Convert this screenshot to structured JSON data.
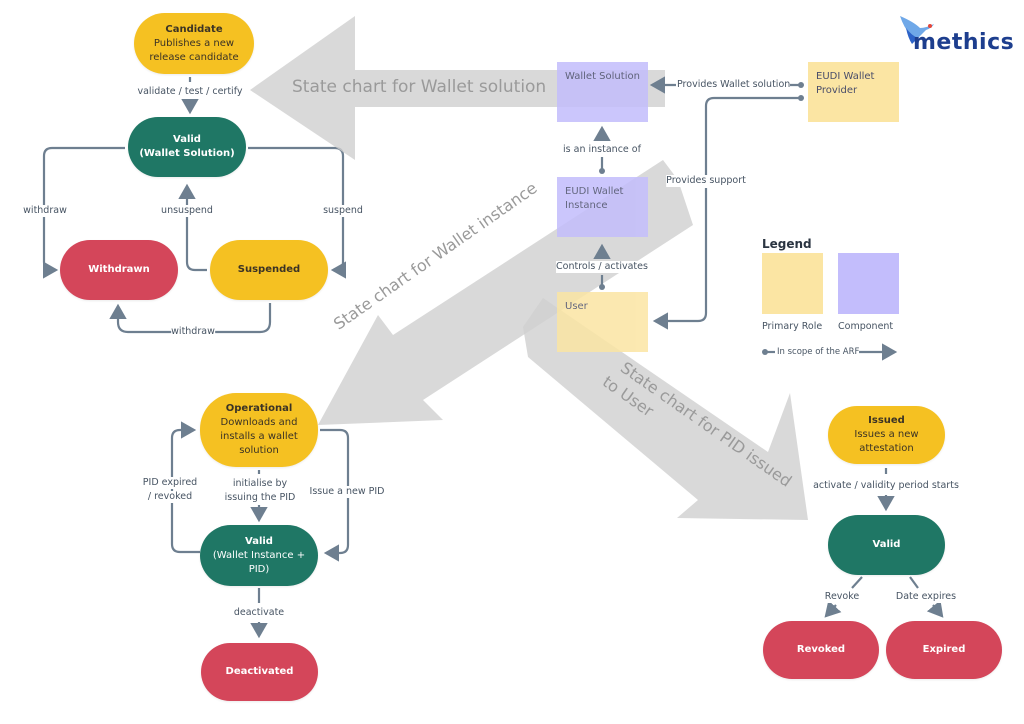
{
  "logo": {
    "text": "methics",
    "icon": "bird-logo-icon"
  },
  "colors": {
    "yellow_state": "#f5c122",
    "green_state": "#1f7765",
    "red_state": "#d4465a",
    "primary_role": "#fbe5a3",
    "component": "#c3bdfc",
    "connector": "#6e7f90",
    "big_arrow": "#d3d3d3"
  },
  "big_arrows": [
    {
      "label": "State chart for Wallet solution"
    },
    {
      "label": "State chart for Wallet instance"
    },
    {
      "label_line1": "State chart for PID issued",
      "label_line2": "to User"
    }
  ],
  "wallet_solution_chart": {
    "candidate": {
      "title": "Candidate",
      "desc1": "Publishes a new",
      "desc2": "release candidate"
    },
    "valid": {
      "title": "Valid",
      "subtitle": "(Wallet Solution)"
    },
    "withdrawn": {
      "title": "Withdrawn"
    },
    "suspended": {
      "title": "Suspended"
    },
    "transitions": {
      "validate": "validate / test / certify",
      "withdraw_left": "withdraw",
      "unsuspend": "unsuspend",
      "suspend": "suspend",
      "withdraw_bottom": "withdraw"
    }
  },
  "wallet_instance_chart": {
    "operational": {
      "title": "Operational",
      "desc1": "Downloads and",
      "desc2": "installs a wallet",
      "desc3": "solution"
    },
    "valid": {
      "title": "Valid",
      "subtitle1": "(Wallet Instance +",
      "subtitle2": "PID)"
    },
    "deactivated": {
      "title": "Deactivated"
    },
    "transitions": {
      "initialise1": "initialise by",
      "initialise2": "issuing the PID",
      "pid_expired1": "PID expired",
      "pid_expired2": "/ revoked",
      "issue_new": "Issue a new PID",
      "deactivate": "deactivate"
    }
  },
  "pid_chart": {
    "issued": {
      "title": "Issued",
      "desc1": "Issues a new",
      "desc2": "attestation"
    },
    "valid": {
      "title": "Valid"
    },
    "revoked": {
      "title": "Revoked"
    },
    "expired": {
      "title": "Expired"
    },
    "transitions": {
      "activate": "activate / validity period starts",
      "revoke": "Revoke",
      "date_expires": "Date expires"
    }
  },
  "architecture": {
    "wallet_solution": "Wallet Solution",
    "wallet_instance1": "EUDI Wallet",
    "wallet_instance2": "Instance",
    "user": "User",
    "provider1": "EUDI Wallet",
    "provider2": "Provider",
    "rel_provides_solution": "Provides Wallet solution",
    "rel_instance_of": "is an instance of",
    "rel_controls": "Controls / activates",
    "rel_support": "Provides support"
  },
  "legend": {
    "title": "Legend",
    "primary_role": "Primary Role",
    "component": "Component",
    "scope": "In scope of the ARF"
  }
}
